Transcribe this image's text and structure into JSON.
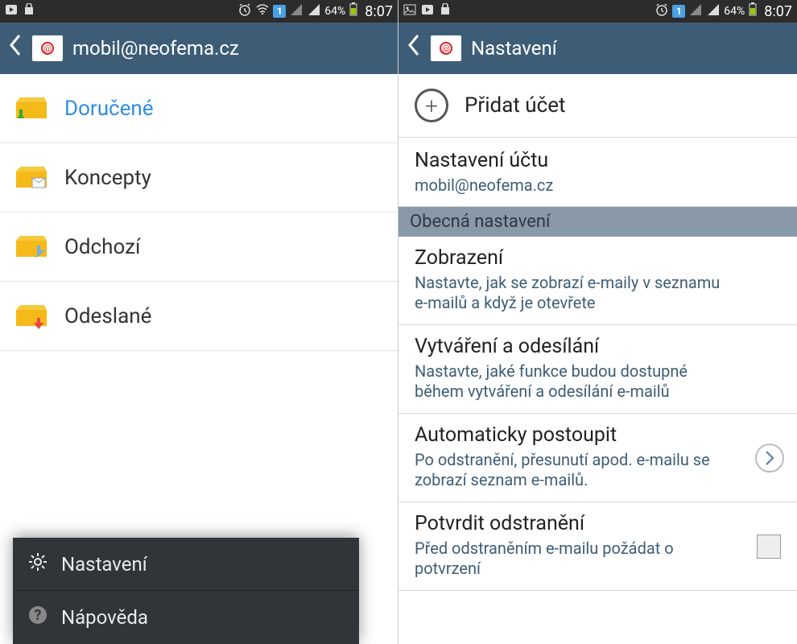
{
  "status": {
    "sim_badge": "1",
    "battery_text": "64%",
    "time": "8:07"
  },
  "left": {
    "title": "mobil@neofema.cz",
    "folders": [
      {
        "label": "Doručené",
        "icon": "inbox",
        "active": true
      },
      {
        "label": "Koncepty",
        "icon": "drafts",
        "active": false
      },
      {
        "label": "Odchozí",
        "icon": "outbox",
        "active": false
      },
      {
        "label": "Odeslané",
        "icon": "sent",
        "active": false
      }
    ],
    "popup": [
      {
        "label": "Nastavení",
        "icon": "gear"
      },
      {
        "label": "Nápověda",
        "icon": "help"
      }
    ]
  },
  "right": {
    "title": "Nastavení",
    "add_account": "Přidat účet",
    "account_title": "Nastavení účtu",
    "account_sub": "mobil@neofema.cz",
    "section_general": "Obecná nastavení",
    "items": [
      {
        "t": "Zobrazení",
        "s": "Nastavte, jak se zobrazí e-maily v seznamu e-mailů a když je otevřete"
      },
      {
        "t": "Vytváření a odesílání",
        "s": "Nastavte, jaké funkce budou dostupné během vytváření a odesílání e-mailů"
      },
      {
        "t": "Automaticky postoupit",
        "s": "Po odstranění, přesunutí apod. e-mailu se zobrazí seznam e-mailů."
      },
      {
        "t": "Potvrdit odstranění",
        "s": "Před odstraněním e-mailu požádat o potvrzení"
      }
    ]
  }
}
